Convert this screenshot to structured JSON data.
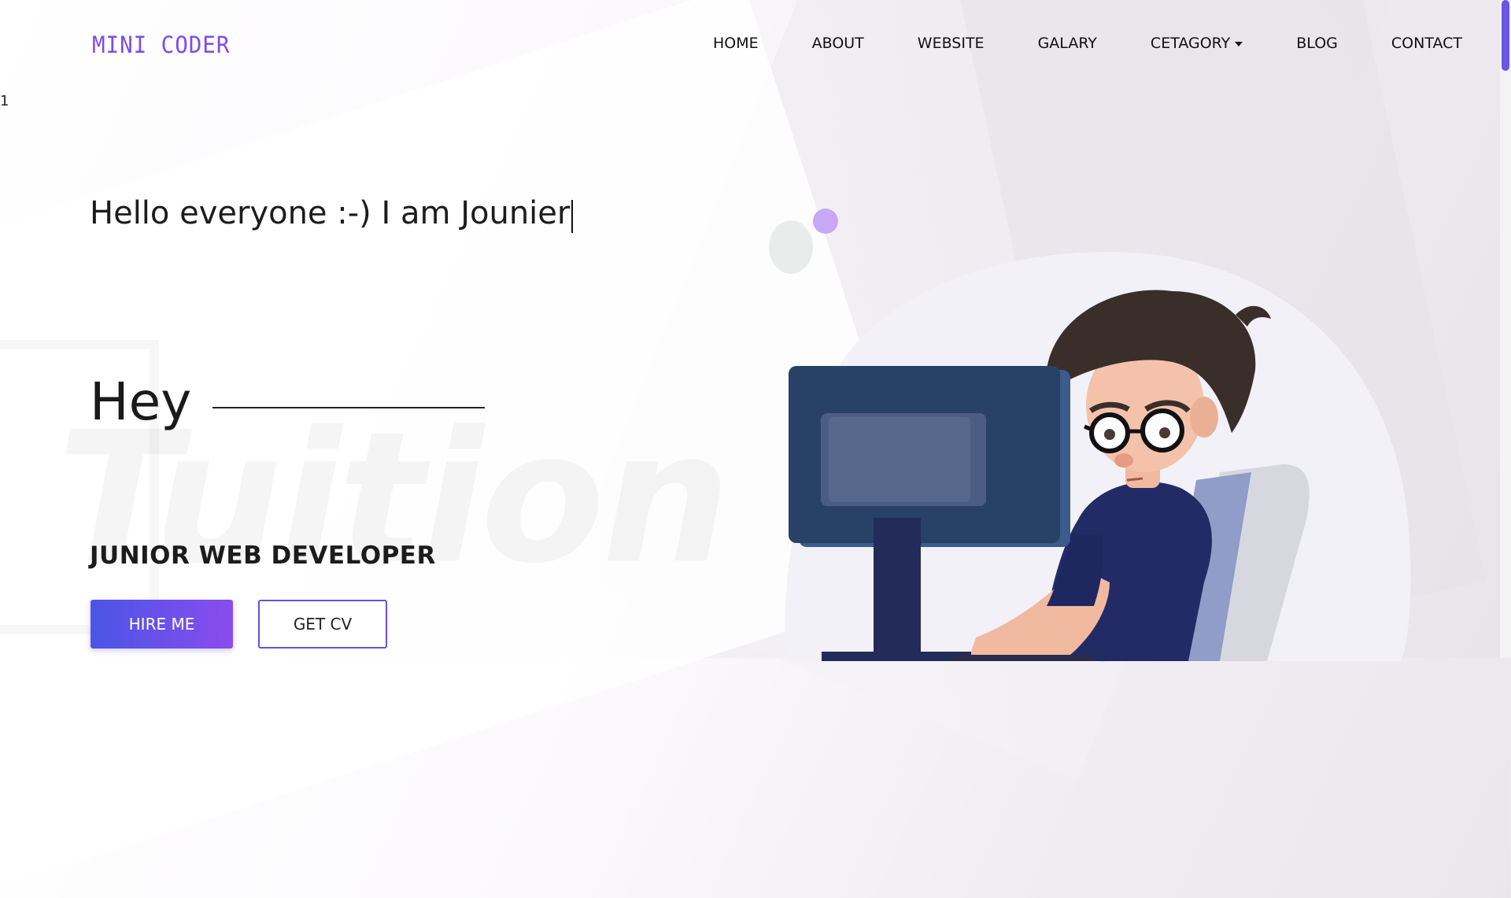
{
  "brand": {
    "logo": "MINI CODER"
  },
  "nav": {
    "items": [
      {
        "label": "HOME"
      },
      {
        "label": "ABOUT"
      },
      {
        "label": "WEBSITE"
      },
      {
        "label": "GALARY"
      },
      {
        "label": "CETAGORY",
        "dropdown": true
      },
      {
        "label": "BLOG"
      },
      {
        "label": "CONTACT"
      }
    ]
  },
  "stray_text": "1",
  "hero": {
    "greeting": "Hello everyone :-) I am Jounier",
    "hey": "Hey",
    "watermark": "Tuition",
    "role": "JUNIOR WEB DEVELOPER",
    "hire_label": "HIRE ME",
    "cv_label": "GET CV"
  },
  "illustration_icon": "developer-at-computer-illustration",
  "colors": {
    "accent": "#7b4cf0",
    "button_start": "#4a55e6",
    "button_end": "#8a4ced",
    "scroll_thumb": "#6a55e6"
  }
}
